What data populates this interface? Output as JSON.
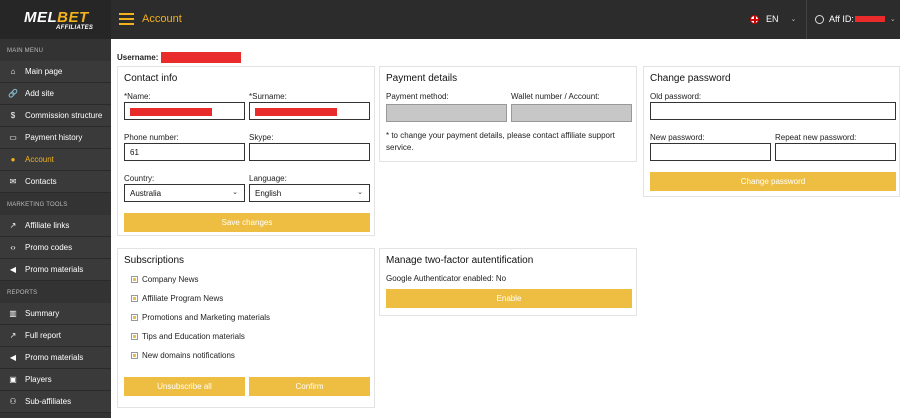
{
  "header": {
    "brand_white": "MEL",
    "brand_yellow": "BET",
    "brand_sub": "AFFILIATES",
    "page_title": "Account",
    "language": "EN",
    "aff_label": "Aff ID:"
  },
  "sidebar": {
    "sections": [
      {
        "title": "MAIN MENU",
        "items": [
          {
            "label": "Main page",
            "icon": "home-icon",
            "glyph": "⌂"
          },
          {
            "label": "Add site",
            "icon": "link-icon",
            "glyph": "🔗"
          },
          {
            "label": "Commission structure",
            "icon": "dollar-icon",
            "glyph": "$"
          },
          {
            "label": "Payment history",
            "icon": "card-icon",
            "glyph": "▭"
          },
          {
            "label": "Account",
            "icon": "user-icon",
            "glyph": "●",
            "active": true
          },
          {
            "label": "Contacts",
            "icon": "envelope-icon",
            "glyph": "✉"
          }
        ]
      },
      {
        "title": "MARKETING TOOLS",
        "items": [
          {
            "label": "Affiliate links",
            "icon": "external-link-icon",
            "glyph": "↗"
          },
          {
            "label": "Promo codes",
            "icon": "code-icon",
            "glyph": "‹›"
          },
          {
            "label": "Promo materials",
            "icon": "megaphone-icon",
            "glyph": "◀"
          }
        ]
      },
      {
        "title": "REPORTS",
        "items": [
          {
            "label": "Summary",
            "icon": "bar-chart-icon",
            "glyph": "▥"
          },
          {
            "label": "Full report",
            "icon": "line-chart-icon",
            "glyph": "↗"
          },
          {
            "label": "Promo materials",
            "icon": "megaphone-icon",
            "glyph": "◀"
          },
          {
            "label": "Players",
            "icon": "id-card-icon",
            "glyph": "▣"
          },
          {
            "label": "Sub-affiliates",
            "icon": "users-icon",
            "glyph": "⚇"
          }
        ]
      }
    ]
  },
  "main": {
    "username_label": "Username:",
    "contact": {
      "title": "Contact info",
      "name_label": "*Name:",
      "surname_label": "*Surname:",
      "phone_label": "Phone number:",
      "phone_value": "61",
      "skype_label": "Skype:",
      "country_label": "Country:",
      "country_value": "Australia",
      "language_label": "Language:",
      "language_value": "English",
      "save_label": "Save changes"
    },
    "payment": {
      "title": "Payment details",
      "method_label": "Payment method:",
      "wallet_label": "Wallet number / Account:",
      "note": "* to change your payment details, please contact affiliate support service."
    },
    "password": {
      "title": "Change password",
      "old_label": "Old password:",
      "new_label": "New password:",
      "repeat_label": "Repeat new password:",
      "button_label": "Change password"
    },
    "subscriptions": {
      "title": "Subscriptions",
      "items": [
        "Company News",
        "Affiliate Program News",
        "Promotions and Marketing materials",
        "Tips and Education materials",
        "New domains notifications"
      ],
      "unsubscribe_label": "Unsubscribe all",
      "confirm_label": "Confirm"
    },
    "twofactor": {
      "title": "Manage two-factor autentification",
      "status": "Google Authenticator enabled: No",
      "enable_label": "Enable"
    }
  },
  "colors": {
    "accent": "#f2b21c",
    "button": "#eebe42",
    "redaction": "#ea2b2b",
    "sidebar": "#333333"
  }
}
